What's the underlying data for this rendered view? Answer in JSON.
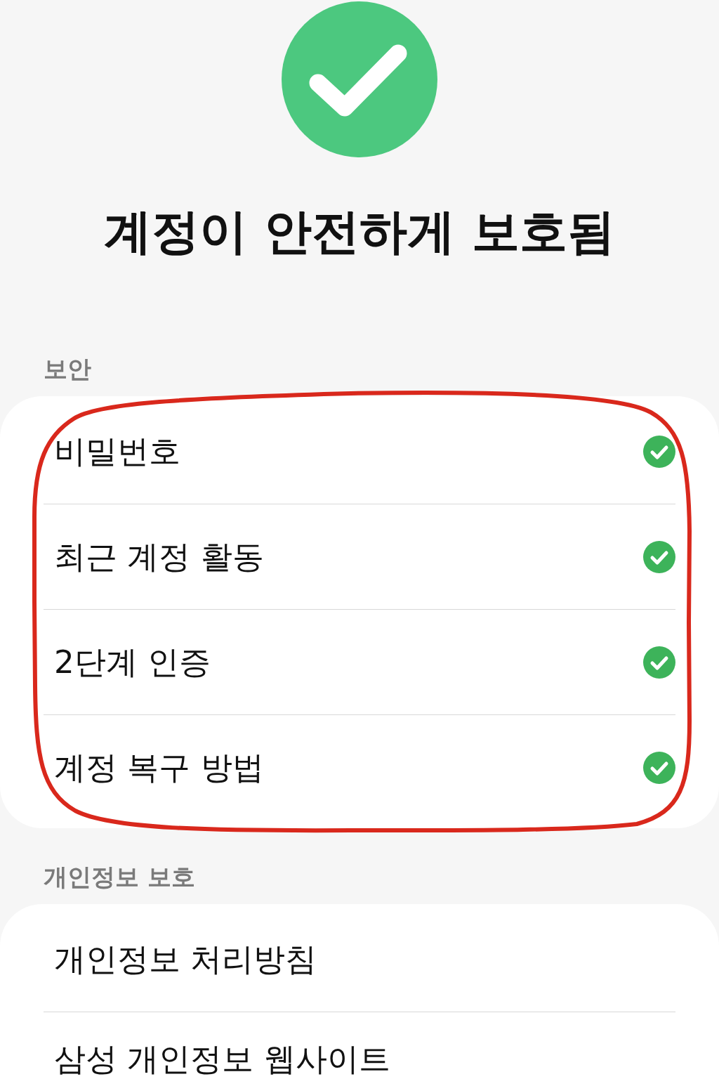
{
  "hero": {
    "title": "계정이 안전하게 보호됨"
  },
  "sections": [
    {
      "header": "보안",
      "circled": true,
      "items": [
        {
          "label": "비밀번호",
          "verified": true
        },
        {
          "label": "최근 계정 활동",
          "verified": true
        },
        {
          "label": "2단계 인증",
          "verified": true
        },
        {
          "label": "계정 복구 방법",
          "verified": true
        }
      ]
    },
    {
      "header": "개인정보 보호",
      "circled": false,
      "items": [
        {
          "label": "개인정보 처리방침",
          "verified": false
        },
        {
          "label": "삼성 개인정보 웹사이트",
          "verified": false
        }
      ]
    }
  ]
}
